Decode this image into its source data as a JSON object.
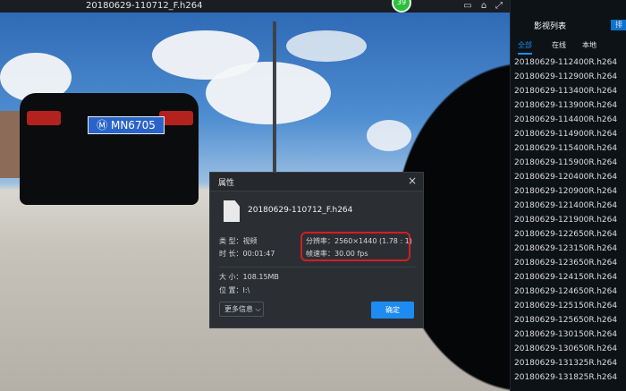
{
  "window": {
    "title": "20180629-110712_F.h264",
    "badge": "39"
  },
  "dialog": {
    "title": "属性",
    "close_label": "×",
    "file_name": "20180629-110712_F.h264",
    "type": "类 型：视频",
    "duration": "时 长：00:01:47",
    "resolution": "分辨率：2560×1440 (1.78 : 1)",
    "framerate": "帧速率：30.00 fps",
    "size": "大 小：108.15MB",
    "location": "位 置：I:\\",
    "more_label": "更多信息 ⌵",
    "ok_label": "确定"
  },
  "playlist": {
    "title": "影视列表",
    "side_label": "排",
    "tabs": [
      "全部",
      "在线",
      "本地"
    ],
    "items": [
      "20180629-112400R.h264",
      "20180629-112900R.h264",
      "20180629-113400R.h264",
      "20180629-113900R.h264",
      "20180629-114400R.h264",
      "20180629-114900R.h264",
      "20180629-115400R.h264",
      "20180629-115900R.h264",
      "20180629-120400R.h264",
      "20180629-120900R.h264",
      "20180629-121400R.h264",
      "20180629-121900R.h264",
      "20180629-122650R.h264",
      "20180629-123150R.h264",
      "20180629-123650R.h264",
      "20180629-124150R.h264",
      "20180629-124650R.h264",
      "20180629-125150R.h264",
      "20180629-125650R.h264",
      "20180629-130150R.h264",
      "20180629-130650R.h264",
      "20180629-131325R.h264",
      "20180629-131825R.h264"
    ]
  },
  "car": {
    "plate": "Ⓜ MN6705"
  },
  "icons": [
    "chat-icon",
    "pin-icon",
    "fullscreen-icon"
  ],
  "colors": {
    "accent": "#1e8bf0",
    "highlight": "#d11f23",
    "badge": "#2bbf3a"
  }
}
